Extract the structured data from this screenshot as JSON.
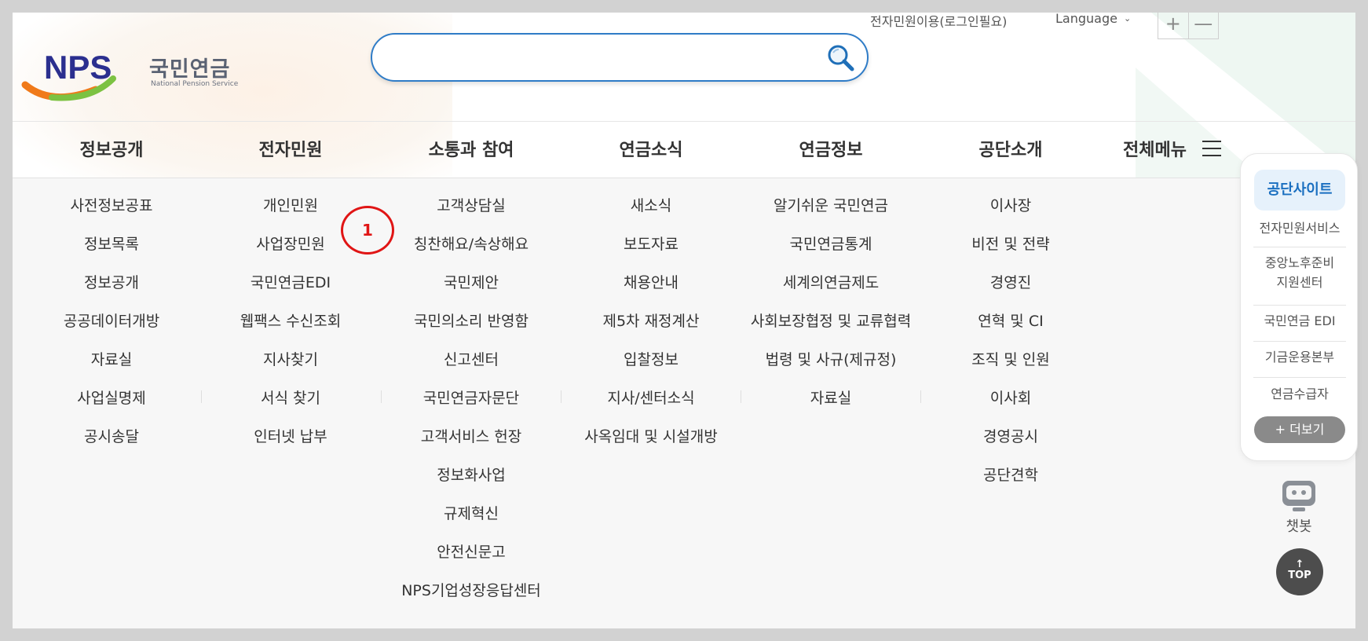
{
  "header": {
    "logo_ko": "국민연금",
    "logo_en": "National Pension Service",
    "logo_mark": "NPS",
    "search_placeholder": "",
    "util_login": "전자민원이용(로그인필요)",
    "util_language": "Language",
    "zoom_in": "+",
    "zoom_out": "—"
  },
  "gnb": {
    "items": [
      "정보공개",
      "전자민원",
      "소통과 참여",
      "연금소식",
      "연금정보",
      "공단소개"
    ],
    "all_menu": "전체메뉴"
  },
  "mega": {
    "columns": [
      [
        "사전정보공표",
        "정보목록",
        "정보공개",
        "공공데이터개방",
        "자료실",
        "사업실명제",
        "공시송달"
      ],
      [
        "개인민원",
        "사업장민원",
        "국민연금EDI",
        "웹팩스 수신조회",
        "지사찾기",
        "서식 찾기",
        "인터넷 납부"
      ],
      [
        "고객상담실",
        "칭찬해요/속상해요",
        "국민제안",
        "국민의소리 반영함",
        "신고센터",
        "국민연금자문단",
        "고객서비스 헌장",
        "정보화사업",
        "규제혁신",
        "안전신문고",
        "NPS기업성장응답센터"
      ],
      [
        "새소식",
        "보도자료",
        "채용안내",
        "제5차 재정계산",
        "입찰정보",
        "지사/센터소식",
        "사옥임대 및 시설개방"
      ],
      [
        "알기쉬운 국민연금",
        "국민연금통계",
        "세계의연금제도",
        "사회보장협정 및 교류협력",
        "법령 및 사규(제규정)",
        "자료실"
      ],
      [
        "이사장",
        "비전 및 전략",
        "경영진",
        "연혁 및 CI",
        "조직 및 인원",
        "이사회",
        "경영공시",
        "공단견학"
      ]
    ],
    "marker_label": "1"
  },
  "quick": {
    "title": "공단사이트",
    "links": [
      "전자민원서비스",
      "중앙노후준비\n지원센터",
      "국민연금 EDI",
      "기금운용본부",
      "연금수급자"
    ],
    "more": "+ 더보기"
  },
  "chatbot_label": "챗봇",
  "top_label": "TOP",
  "colors": {
    "accent_blue": "#2f7cc7",
    "marker_red": "#e01515",
    "logo_navy": "#2b2f8f",
    "logo_orange": "#f07a1a",
    "logo_green": "#7cc242"
  }
}
